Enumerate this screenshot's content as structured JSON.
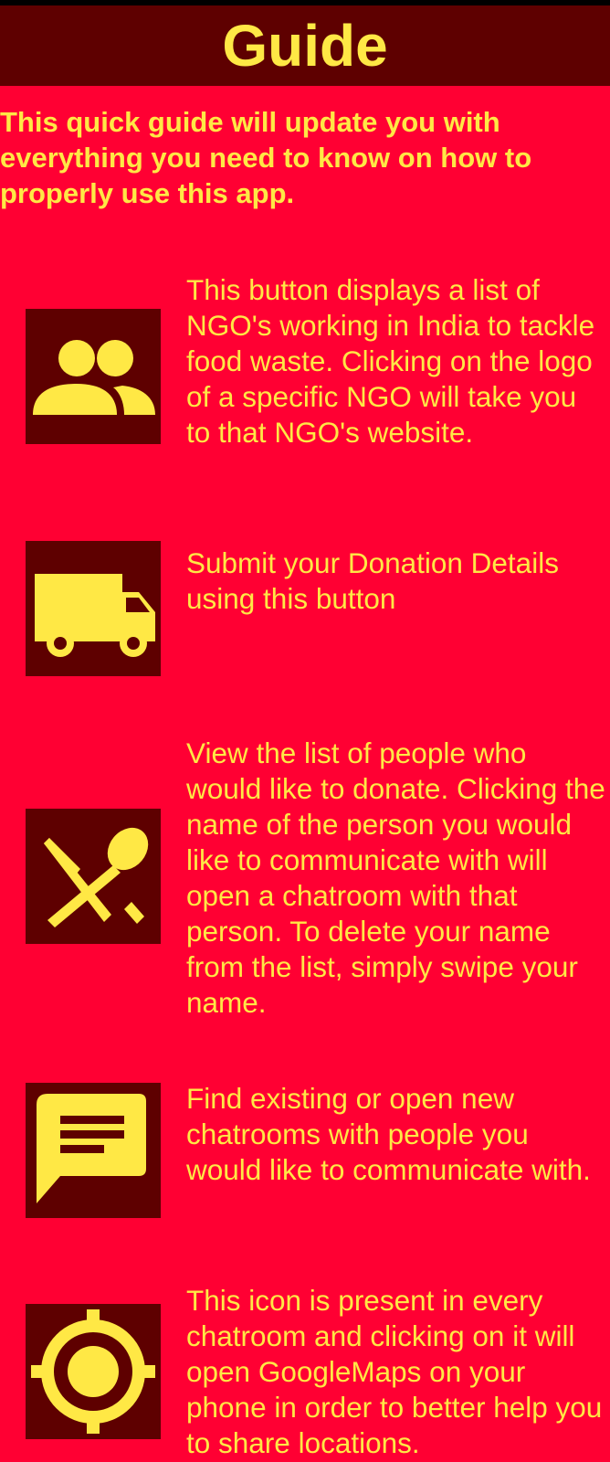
{
  "header": {
    "title": "Guide"
  },
  "intro": {
    "text": "This quick guide will update you with everything you need to know on how to properly use this app."
  },
  "colors": {
    "background": "#ff0033",
    "header_bg": "#5e0000",
    "icon_bg": "#5e0000",
    "accent_text": "#ffe845"
  },
  "items": [
    {
      "icon": "group-icon",
      "text": "This button displays a list of NGO's working in India to tackle food waste. Clicking on the logo of a specific NGO will take you to that NGO's website."
    },
    {
      "icon": "truck-icon",
      "text": "Submit your Donation Details using this button"
    },
    {
      "icon": "restaurant-icon",
      "text": "View the list of people who would like to donate. Clicking the name of the person you would like to communicate with will open a chatroom with that person. To delete your name from the list, simply swipe your name."
    },
    {
      "icon": "chat-icon",
      "text": "Find existing or open new chatrooms with people you would like to communicate with."
    },
    {
      "icon": "location-icon",
      "text": "This icon is present in every chatroom and clicking on it will open GoogleMaps on your phone in order to better help you to share locations."
    }
  ]
}
